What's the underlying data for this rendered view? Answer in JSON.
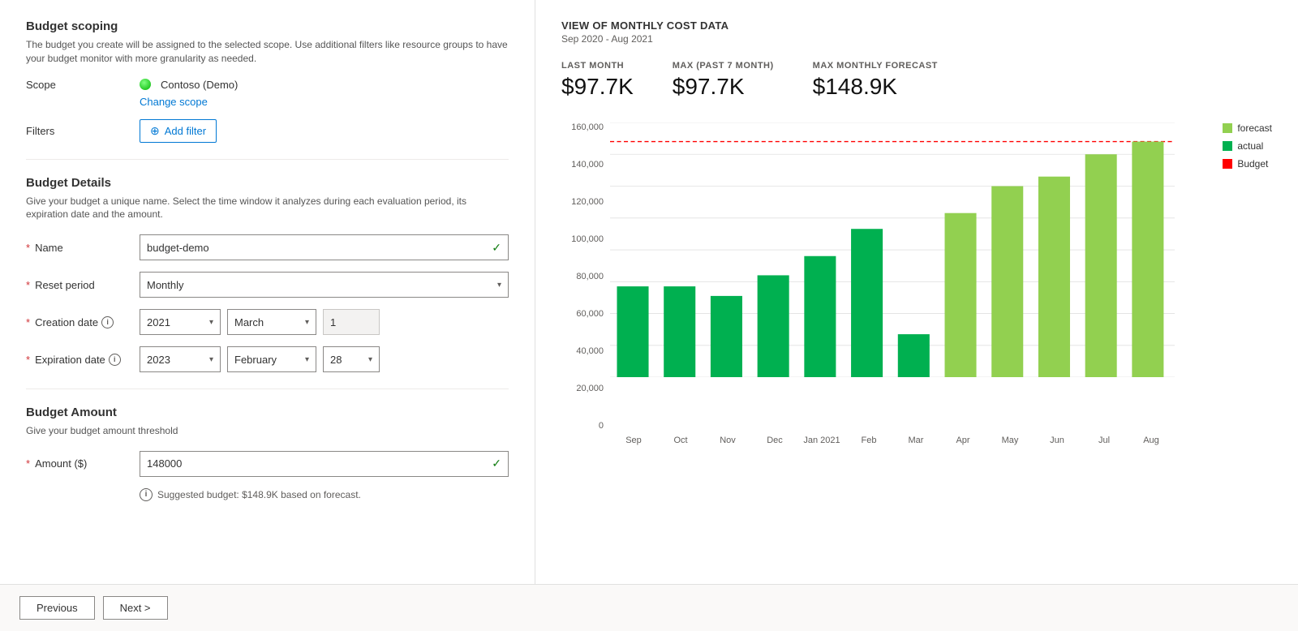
{
  "left": {
    "budget_scoping": {
      "title": "Budget scoping",
      "desc": "The budget you create will be assigned to the selected scope. Use additional filters like resource groups to have your budget monitor with more granularity as needed.",
      "scope_label": "Scope",
      "scope_value": "Contoso (Demo)",
      "change_scope": "Change scope",
      "filters_label": "Filters",
      "add_filter": "Add filter"
    },
    "budget_details": {
      "title": "Budget Details",
      "desc": "Give your budget a unique name. Select the time window it analyzes during each evaluation period, its expiration date and the amount.",
      "name_label": "Name",
      "name_value": "budget-demo",
      "reset_label": "Reset period",
      "reset_value": "Monthly",
      "creation_label": "Creation date",
      "creation_year": "2021",
      "creation_month": "March",
      "creation_day": "1",
      "expiration_label": "Expiration date",
      "expiration_year": "2023",
      "expiration_month": "February",
      "expiration_day": "28"
    },
    "budget_amount": {
      "title": "Budget Amount",
      "desc": "Give your budget amount threshold",
      "amount_label": "Amount ($)",
      "amount_value": "148000",
      "suggested_text": "Suggested budget: $148.9K based on forecast."
    }
  },
  "right": {
    "chart_title": "VIEW OF MONTHLY COST DATA",
    "chart_subtitle": "Sep 2020 - Aug 2021",
    "metrics": [
      {
        "label": "LAST MONTH",
        "value": "$97.7K"
      },
      {
        "label": "MAX (PAST 7 MONTH)",
        "value": "$97.7K"
      },
      {
        "label": "MAX MONTHLY FORECAST",
        "value": "$148.9K"
      }
    ],
    "legend": [
      {
        "label": "forecast",
        "color": "#92d050",
        "type": "light"
      },
      {
        "label": "actual",
        "color": "#00b050",
        "type": "solid"
      },
      {
        "label": "Budget",
        "color": "#ff0000",
        "type": "dashed"
      }
    ],
    "y_labels": [
      "160,000",
      "140,000",
      "120,000",
      "100,000",
      "80,000",
      "60,000",
      "40,000",
      "20,000",
      "0"
    ],
    "x_labels": [
      "Sep",
      "Oct",
      "Nov",
      "Dec",
      "Jan 2021",
      "Feb",
      "Mar",
      "Apr",
      "May",
      "Jun",
      "Jul",
      "Aug"
    ],
    "bars": [
      {
        "month": "Sep",
        "value": 57000,
        "type": "actual"
      },
      {
        "month": "Oct",
        "value": 57000,
        "type": "actual"
      },
      {
        "month": "Nov",
        "value": 51000,
        "type": "actual"
      },
      {
        "month": "Dec",
        "value": 64000,
        "type": "actual"
      },
      {
        "month": "Jan 2021",
        "value": 76000,
        "type": "actual"
      },
      {
        "month": "Feb",
        "value": 93000,
        "type": "actual"
      },
      {
        "month": "Mar",
        "value": 27000,
        "type": "actual"
      },
      {
        "month": "Apr",
        "value": 103000,
        "type": "forecast"
      },
      {
        "month": "May",
        "value": 120000,
        "type": "forecast"
      },
      {
        "month": "Jun",
        "value": 126000,
        "type": "forecast"
      },
      {
        "month": "Jul",
        "value": 140000,
        "type": "forecast"
      },
      {
        "month": "Aug",
        "value": 148000,
        "type": "forecast"
      }
    ],
    "budget_line": 148000,
    "max_value": 160000
  },
  "footer": {
    "prev_label": "Previous",
    "next_label": "Next >"
  }
}
